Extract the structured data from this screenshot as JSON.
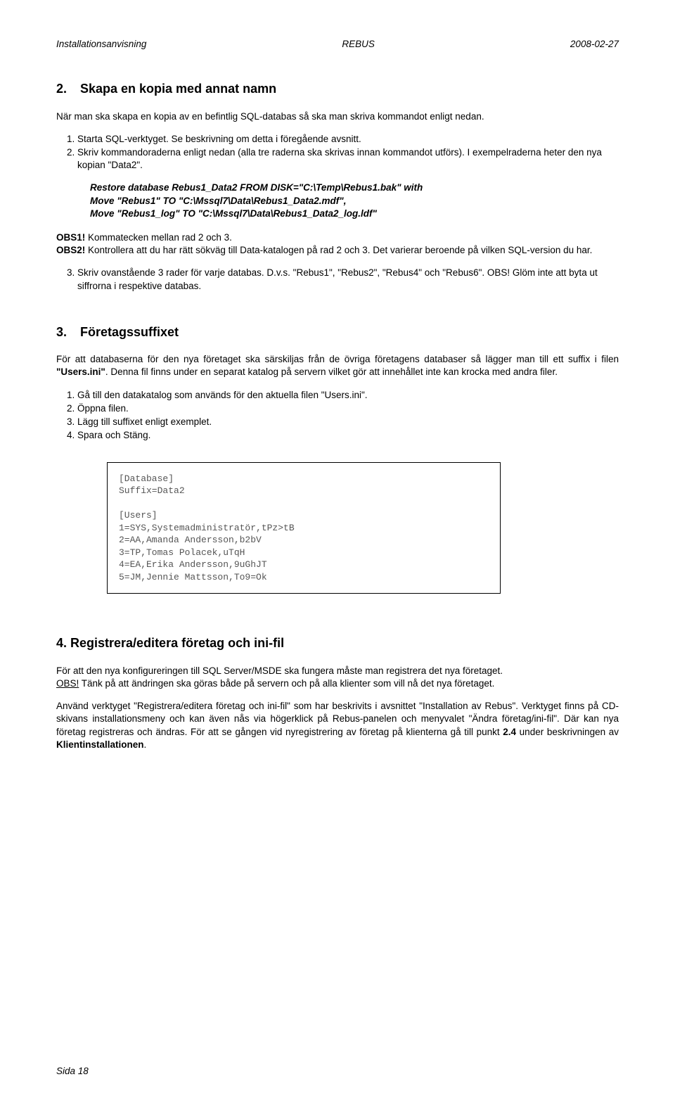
{
  "header": {
    "left": "Installationsanvisning",
    "center": "REBUS",
    "right": "2008-02-27"
  },
  "sec2": {
    "title_num": "2.",
    "title": "Skapa en kopia med annat namn",
    "intro": "När man ska skapa en kopia av en befintlig SQL-databas så ska man skriva kommandot enligt nedan.",
    "steps": {
      "s1": "Starta SQL-verktyget. Se beskrivning om detta i föregående avsnitt.",
      "s2": "Skriv kommandoraderna enligt nedan (alla tre raderna ska skrivas innan kommandot utförs). I exempelraderna heter den nya kopian \"Data2\"."
    },
    "code": {
      "l1": "Restore database Rebus1_Data2 FROM DISK=\"C:\\Temp\\Rebus1.bak\" with",
      "l2": "Move \"Rebus1\" TO \"C:\\Mssql7\\Data\\Rebus1_Data2.mdf\",",
      "l3": "Move \"Rebus1_log\" TO \"C:\\Mssql7\\Data\\Rebus1_Data2_log.ldf\""
    },
    "obs1_label": "OBS1!",
    "obs1_text": " Kommatecken mellan rad 2 och 3.",
    "obs2_label": "OBS2!",
    "obs2_text": " Kontrollera att du har rätt sökväg till Data-katalogen på rad 2 och 3. Det varierar beroende på vilken SQL-version du har.",
    "step3": "Skriv ovanstående 3 rader för varje databas. D.v.s. \"Rebus1\", \"Rebus2\", \"Rebus4\" och \"Rebus6\". OBS! Glöm inte att byta ut siffrorna i respektive databas."
  },
  "sec3": {
    "title_num": "3.",
    "title": "Företagssuffixet",
    "p1a": "För att databaserna för den nya företaget ska särskiljas från de övriga företagens databaser så lägger man till ett suffix i filen ",
    "p1b": "\"Users.ini\"",
    "p1c": ". Denna fil finns under en separat katalog på servern vilket gör att innehållet inte kan krocka med andra filer.",
    "steps": {
      "s1": "Gå till den datakatalog som används för den aktuella filen \"Users.ini\".",
      "s2": "Öppna filen.",
      "s3": "Lägg till suffixet enligt exemplet.",
      "s4": "Spara och Stäng."
    },
    "code": {
      "l1": "[Database]",
      "l2": "Suffix=Data2",
      "l3": "",
      "l4": "[Users]",
      "l5": "1=SYS,Systemadministratör,tPz>tB",
      "l6": "2=AA,Amanda Andersson,b2bV",
      "l7": "3=TP,Tomas Polacek,uTqH",
      "l8": "4=EA,Erika Andersson,9uGhJT",
      "l9": "5=JM,Jennie Mattsson,To9=Ok"
    }
  },
  "sec4": {
    "title": "4. Registrera/editera företag och ini-fil",
    "p1": "För att den nya konfigureringen till SQL Server/MSDE ska fungera måste man registrera det nya företaget.",
    "obs_label": "OBS!",
    "p1b": " Tänk på att ändringen ska göras både på servern och på alla klienter som vill nå det nya företaget.",
    "p2a": "Använd verktyget \"Registrera/editera företag och ini-fil\" som har beskrivits i avsnittet \"Installation av Rebus\". Verktyget finns på CD-skivans installationsmeny och kan även nås via högerklick på Rebus-panelen och menyvalet \"Ändra företag/ini-fil\". Där kan nya företag registreras och ändras. För att se gången vid nyregistrering av företag på klienterna gå till punkt ",
    "p2b": "2.4",
    "p2c": " under beskrivningen av ",
    "p2d": "Klientinstallationen",
    "p2e": "."
  },
  "footer": "Sida  18"
}
